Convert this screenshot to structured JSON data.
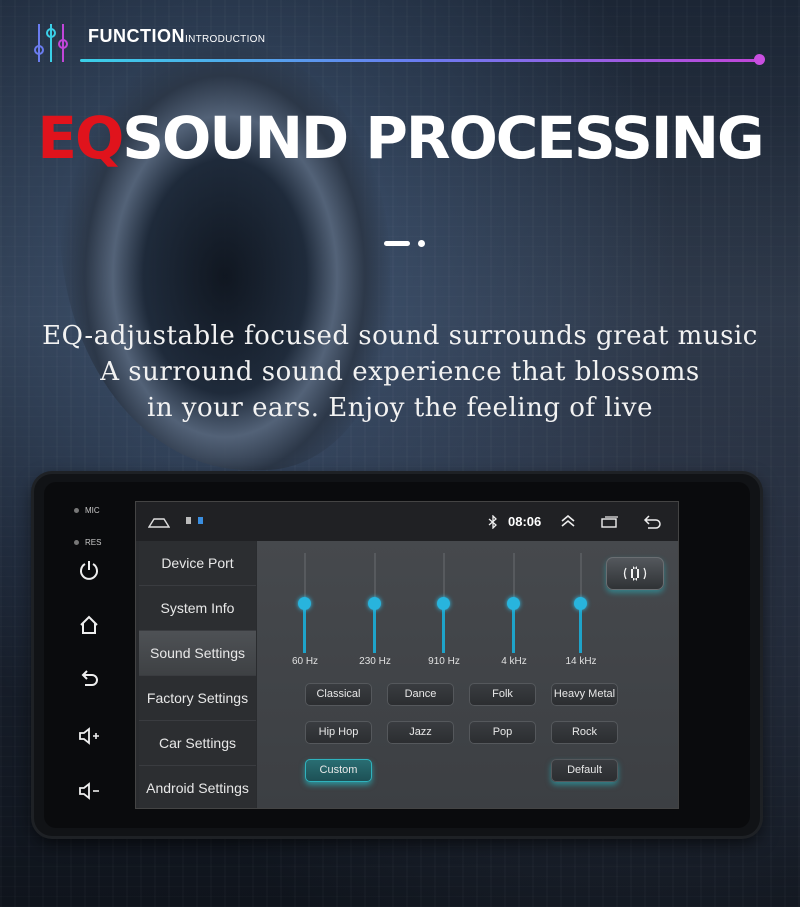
{
  "header": {
    "title": "FUNCTION",
    "subtitle": "INTRODUCTION",
    "headline_accent": "EQ",
    "headline_rest": "SOUND PROCESSING",
    "tagline": [
      "EQ-adjustable focused sound surrounds great music",
      "A surround sound experience that blossoms",
      "in your ears. Enjoy the feeling of live"
    ]
  },
  "device": {
    "mic_label": "MIC",
    "res_label": "RES",
    "side_buttons": [
      "power-icon",
      "home-icon",
      "back-icon",
      "volume-up-icon",
      "volume-down-icon"
    ]
  },
  "statusbar": {
    "time": "08:06",
    "icons": [
      "home-outline-icon",
      "sd-card-icon",
      "bluetooth-icon",
      "expand-up-icon",
      "recent-apps-icon",
      "back-arrow-icon"
    ]
  },
  "menu": {
    "items": [
      {
        "label": "Device Port",
        "active": false
      },
      {
        "label": "System Info",
        "active": false
      },
      {
        "label": "Sound Settings",
        "active": true
      },
      {
        "label": "Factory Settings",
        "active": false
      },
      {
        "label": "Car Settings",
        "active": false
      },
      {
        "label": "Android Settings",
        "active": false
      }
    ]
  },
  "equalizer": {
    "bands": [
      {
        "label": "60 Hz",
        "level": 0.0
      },
      {
        "label": "230 Hz",
        "level": 0.0
      },
      {
        "label": "910 Hz",
        "level": 0.0
      },
      {
        "label": "4 kHz",
        "level": 0.0
      },
      {
        "label": "14 kHz",
        "level": 0.0
      }
    ],
    "presets": [
      {
        "label": "Classical",
        "selected": false
      },
      {
        "label": "Dance",
        "selected": false
      },
      {
        "label": "Folk",
        "selected": false
      },
      {
        "label": "Heavy Metal",
        "selected": false
      },
      {
        "label": "Hip Hop",
        "selected": false
      },
      {
        "label": "Jazz",
        "selected": false
      },
      {
        "label": "Pop",
        "selected": false
      },
      {
        "label": "Rock",
        "selected": false
      },
      {
        "label": "Custom",
        "selected": true
      }
    ],
    "default_label": "Default"
  },
  "colors": {
    "accent": "#1ea3c9",
    "headline_red": "#e0131c"
  }
}
